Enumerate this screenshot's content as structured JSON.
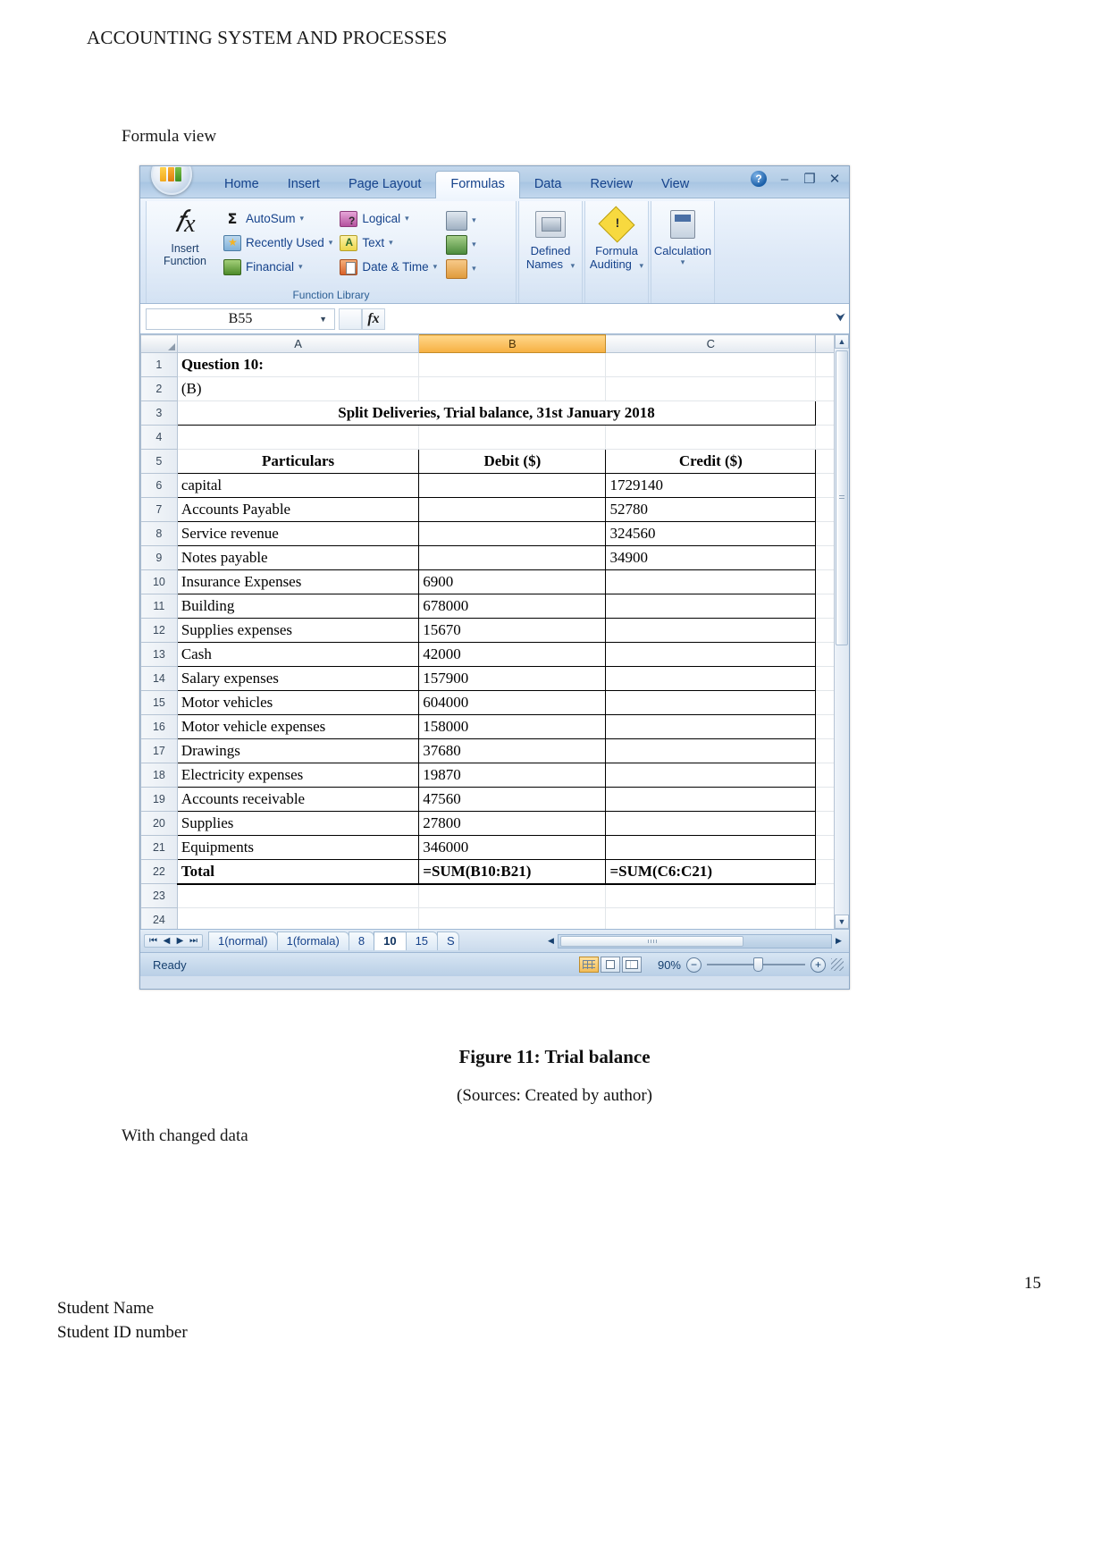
{
  "document": {
    "header": "ACCOUNTING SYSTEM AND PROCESSES",
    "label_formula_view": "Formula view",
    "figure_caption": "Figure 11: Trial balance",
    "figure_source": "(Sources: Created by author)",
    "label_changed_data": "With changed data",
    "page_number": "15",
    "footer_line1": "Student Name",
    "footer_line2": "Student ID number"
  },
  "excel": {
    "ribbon_tabs": [
      {
        "label": "Home",
        "active": false
      },
      {
        "label": "Insert",
        "active": false
      },
      {
        "label": "Page Layout",
        "active": false
      },
      {
        "label": "Formulas",
        "active": true
      },
      {
        "label": "Data",
        "active": false
      },
      {
        "label": "Review",
        "active": false
      },
      {
        "label": "View",
        "active": false
      }
    ],
    "window_controls": {
      "help": "?",
      "minimize": "–",
      "restore": "❐",
      "close": "✕"
    },
    "function_library": {
      "group_label": "Function Library",
      "insert_function": "Insert Function",
      "items": [
        {
          "label": "AutoSum",
          "icon": "sigma-icon"
        },
        {
          "label": "Recently Used",
          "icon": "recently-used-icon"
        },
        {
          "label": "Financial",
          "icon": "financial-icon"
        },
        {
          "label": "Logical",
          "icon": "logical-icon"
        },
        {
          "label": "Text",
          "icon": "text-icon"
        },
        {
          "label": "Date & Time",
          "icon": "date-time-icon"
        }
      ],
      "stacked_icons": [
        {
          "icon": "lookup-reference-icon"
        },
        {
          "icon": "math-trig-icon"
        },
        {
          "icon": "more-functions-icon"
        }
      ]
    },
    "groups": [
      {
        "label_line1": "Defined",
        "label_line2": "Names",
        "icon": "defined-names-icon"
      },
      {
        "label_line1": "Formula",
        "label_line2": "Auditing",
        "icon": "formula-auditing-icon"
      },
      {
        "label_line1": "Calculation",
        "label_line2": "",
        "icon": "calculation-icon"
      }
    ],
    "name_box": {
      "value": "B55"
    },
    "formula_bar": {
      "value": "",
      "fx_label": "fx"
    },
    "columns": [
      {
        "letter": "A",
        "selected": false
      },
      {
        "letter": "B",
        "selected": true
      },
      {
        "letter": "C",
        "selected": false
      }
    ],
    "rows": [
      {
        "num": "1",
        "a": "Question 10:",
        "b": "",
        "c": "",
        "style": "title"
      },
      {
        "num": "2",
        "a": "(B)",
        "b": "",
        "c": "",
        "style": "plain"
      },
      {
        "num": "3",
        "a": "Split Deliveries, Trial balance, 31st January 2018",
        "b": "",
        "c": "",
        "style": "merged-title"
      },
      {
        "num": "4",
        "a": "",
        "b": "",
        "c": "",
        "style": "blank"
      },
      {
        "num": "5",
        "a": "Particulars",
        "b": "Debit ($)",
        "c": "Credit ($)",
        "style": "header"
      },
      {
        "num": "6",
        "a": "capital",
        "b": "",
        "c": "1729140",
        "style": "data"
      },
      {
        "num": "7",
        "a": "Accounts Payable",
        "b": "",
        "c": "52780",
        "style": "data"
      },
      {
        "num": "8",
        "a": "Service revenue",
        "b": "",
        "c": "324560",
        "style": "data"
      },
      {
        "num": "9",
        "a": "Notes payable",
        "b": "",
        "c": "34900",
        "style": "data"
      },
      {
        "num": "10",
        "a": "Insurance Expenses",
        "b": "6900",
        "c": "",
        "style": "data"
      },
      {
        "num": "11",
        "a": "Building",
        "b": "678000",
        "c": "",
        "style": "data"
      },
      {
        "num": "12",
        "a": "Supplies expenses",
        "b": "15670",
        "c": "",
        "style": "data"
      },
      {
        "num": "13",
        "a": "Cash",
        "b": "42000",
        "c": "",
        "style": "data"
      },
      {
        "num": "14",
        "a": "Salary expenses",
        "b": "157900",
        "c": "",
        "style": "data"
      },
      {
        "num": "15",
        "a": "Motor vehicles",
        "b": "604000",
        "c": "",
        "style": "data"
      },
      {
        "num": "16",
        "a": "Motor vehicle expenses",
        "b": "158000",
        "c": "",
        "style": "data"
      },
      {
        "num": "17",
        "a": "Drawings",
        "b": "37680",
        "c": "",
        "style": "data"
      },
      {
        "num": "18",
        "a": "Electricity expenses",
        "b": "19870",
        "c": "",
        "style": "data"
      },
      {
        "num": "19",
        "a": "Accounts receivable",
        "b": "47560",
        "c": "",
        "style": "data"
      },
      {
        "num": "20",
        "a": "Supplies",
        "b": "27800",
        "c": "",
        "style": "data"
      },
      {
        "num": "21",
        "a": "Equipments",
        "b": "346000",
        "c": "",
        "style": "data"
      },
      {
        "num": "22",
        "a": "Total",
        "b": "=SUM(B10:B21)",
        "c": "=SUM(C6:C21)",
        "style": "total"
      },
      {
        "num": "23",
        "a": "",
        "b": "",
        "c": "",
        "style": "blank"
      },
      {
        "num": "24",
        "a": "",
        "b": "",
        "c": "",
        "style": "blank"
      }
    ],
    "sheet_tabs": [
      {
        "label": "1(normal)",
        "active": false
      },
      {
        "label": "1(formala)",
        "active": false
      },
      {
        "label": "8",
        "active": false
      },
      {
        "label": "10",
        "active": true
      },
      {
        "label": "15",
        "active": false
      },
      {
        "label": "S",
        "active": false
      }
    ],
    "status_bar": {
      "status": "Ready",
      "zoom": "90%",
      "zoom_out": "−",
      "zoom_in": "+",
      "views": [
        {
          "name": "normal-view-button",
          "active": true
        },
        {
          "name": "page-layout-view-button",
          "active": false
        },
        {
          "name": "page-break-view-button",
          "active": false
        }
      ]
    }
  },
  "colors": {
    "selected_column": "#f6b041",
    "ribbon_text": "#15428b",
    "window_bg": "#d3e0ef"
  }
}
